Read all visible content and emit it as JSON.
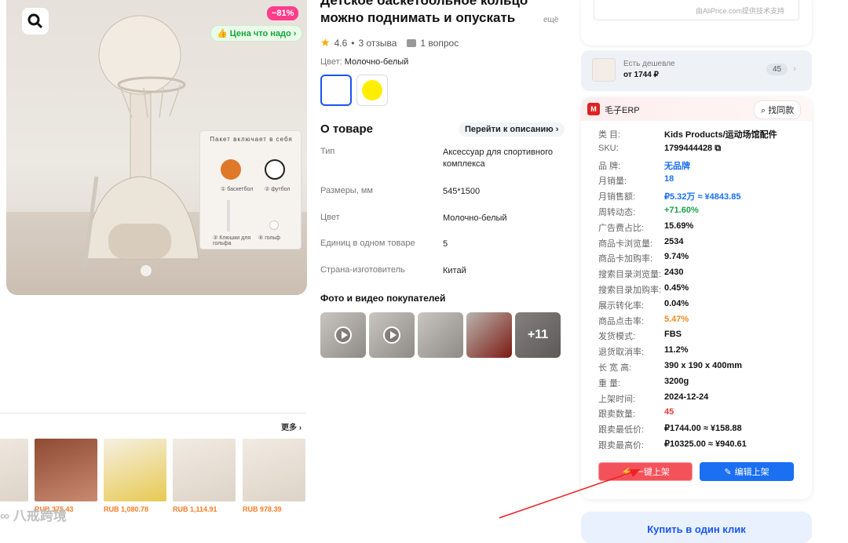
{
  "product": {
    "title": "Детское баскетбольное кольцо можно поднимать и опускать",
    "title_more": "ещё",
    "rating": "4.6",
    "reviews": "3 отзыва",
    "questions": "1 вопрос",
    "discount_badge": "−81%",
    "price_badge": "Цена что надо",
    "color_label": "Цвет: ",
    "color_value": "Молочно-белый",
    "package": {
      "title": "Пакет включает в себя",
      "items": [
        "① баскетбол",
        "② футбол",
        "③ Клюшки для гольфа",
        "④ гольф"
      ]
    }
  },
  "about": {
    "title": "О товаре",
    "goto": "Перейти к описанию",
    "specs": [
      {
        "key": "Тип",
        "value": "Аксессуар для спортивного комплекса"
      },
      {
        "key": "Размеры, мм",
        "value": "545*1500"
      },
      {
        "key": "Цвет",
        "value": "Молочно-белый"
      },
      {
        "key": "Единиц в одном товаре",
        "value": "5"
      },
      {
        "key": "Страна-изготовитель",
        "value": "Китай"
      }
    ]
  },
  "photos": {
    "title": "Фото и видео покупателей",
    "more_count": "+11"
  },
  "related": {
    "more_label": "更多",
    "prices": [
      "RUB 375.43",
      "RUB 1,080.78",
      "RUB 1,114.91",
      "RUB 978.39"
    ]
  },
  "watermark": "八戒跨境",
  "aliprice": "由AliPrice.com提供技术支持",
  "cheaper": {
    "label": "Есть дешевле",
    "price": "от 1744 ₽",
    "count": "45"
  },
  "erp": {
    "name": "毛子ERP",
    "find_label": "找同款",
    "rows": [
      {
        "k": "类  目:",
        "v": "Kids Products/运动场馆配件",
        "c": "#111"
      },
      {
        "k": "SKU:",
        "v": "1799444428 ⧉",
        "c": "#111"
      },
      {
        "k": "品  牌:",
        "v": "无品牌",
        "c": "#1a6ff2"
      },
      {
        "k": "月销量:",
        "v": "18",
        "c": "#1a6ff2"
      },
      {
        "k": "月销售额:",
        "v": "₽5.32万 ≈ ¥4843.85",
        "c": "#1a6ff2"
      },
      {
        "k": "周转动态:",
        "v": "+71.60%",
        "c": "#1aa34a"
      },
      {
        "k": "广告费占比:",
        "v": "15.69%",
        "c": "#111"
      },
      {
        "k": "商品卡浏览量:",
        "v": "2534",
        "c": "#111"
      },
      {
        "k": "商品卡加购率:",
        "v": "9.74%",
        "c": "#111"
      },
      {
        "k": "搜索目录浏览量:",
        "v": "2430",
        "c": "#111"
      },
      {
        "k": "搜索目录加购率:",
        "v": "0.45%",
        "c": "#111"
      },
      {
        "k": "展示转化率:",
        "v": "0.04%",
        "c": "#111"
      },
      {
        "k": "商品点击率:",
        "v": "5.47%",
        "c": "#f08a1c"
      },
      {
        "k": "发货模式:",
        "v": "FBS",
        "c": "#111"
      },
      {
        "k": "退货取消率:",
        "v": "11.2%",
        "c": "#111"
      },
      {
        "k": "长 宽 高:",
        "v": "390 x 190 x 400mm",
        "c": "#111"
      },
      {
        "k": "重  量:",
        "v": "3200g",
        "c": "#111"
      },
      {
        "k": "上架时间:",
        "v": "2024-12-24",
        "c": "#111"
      },
      {
        "k": "跟卖数量:",
        "v": "45",
        "c": "#e5393f"
      },
      {
        "k": "跟卖最低价:",
        "v": "₽1744.00 ≈ ¥158.88",
        "c": "#111"
      },
      {
        "k": "跟卖最高价:",
        "v": "₽10325.00 ≈ ¥940.61",
        "c": "#111"
      }
    ],
    "btn_publish": "一键上架",
    "btn_edit": "编辑上架"
  },
  "buy_one_click": "Купить в один клик",
  "colors": {
    "accent": "#1a55f2",
    "erp_red": "#f4525a",
    "erp_blue": "#1a6ff2"
  }
}
